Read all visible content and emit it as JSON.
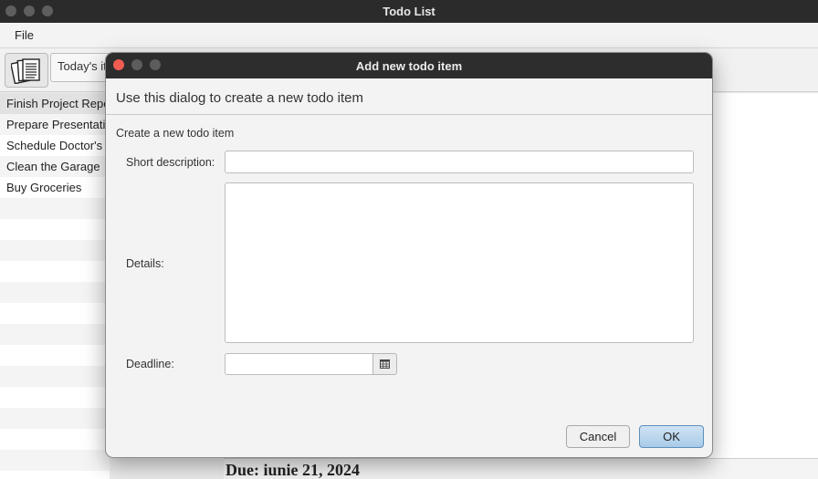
{
  "window": {
    "title": "Todo List"
  },
  "menu": {
    "file_label": "File"
  },
  "toolbar": {
    "new_item_icon": "documents-icon",
    "toggle_label": "Today's items"
  },
  "todo_list": {
    "items": [
      "Finish Project Report",
      "Prepare Presentation",
      "Schedule Doctor's Appointment",
      "Clean the Garage",
      "Buy Groceries"
    ]
  },
  "detail": {
    "due_text": "Due: iunie 21, 2024"
  },
  "dialog": {
    "title": "Add new todo item",
    "header_text": "Use this dialog to create a new todo item",
    "subtitle": "Create a new todo item",
    "short_description_label": "Short description:",
    "short_description_value": "",
    "details_label": "Details:",
    "details_value": "",
    "deadline_label": "Deadline:",
    "deadline_value": "",
    "calendar_icon": "calendar-icon",
    "cancel_label": "Cancel",
    "ok_label": "OK"
  },
  "colors": {
    "titlebar": "#2b2b2b",
    "close_red": "#ee5c52",
    "ok_blue": "#a9cbe8"
  }
}
